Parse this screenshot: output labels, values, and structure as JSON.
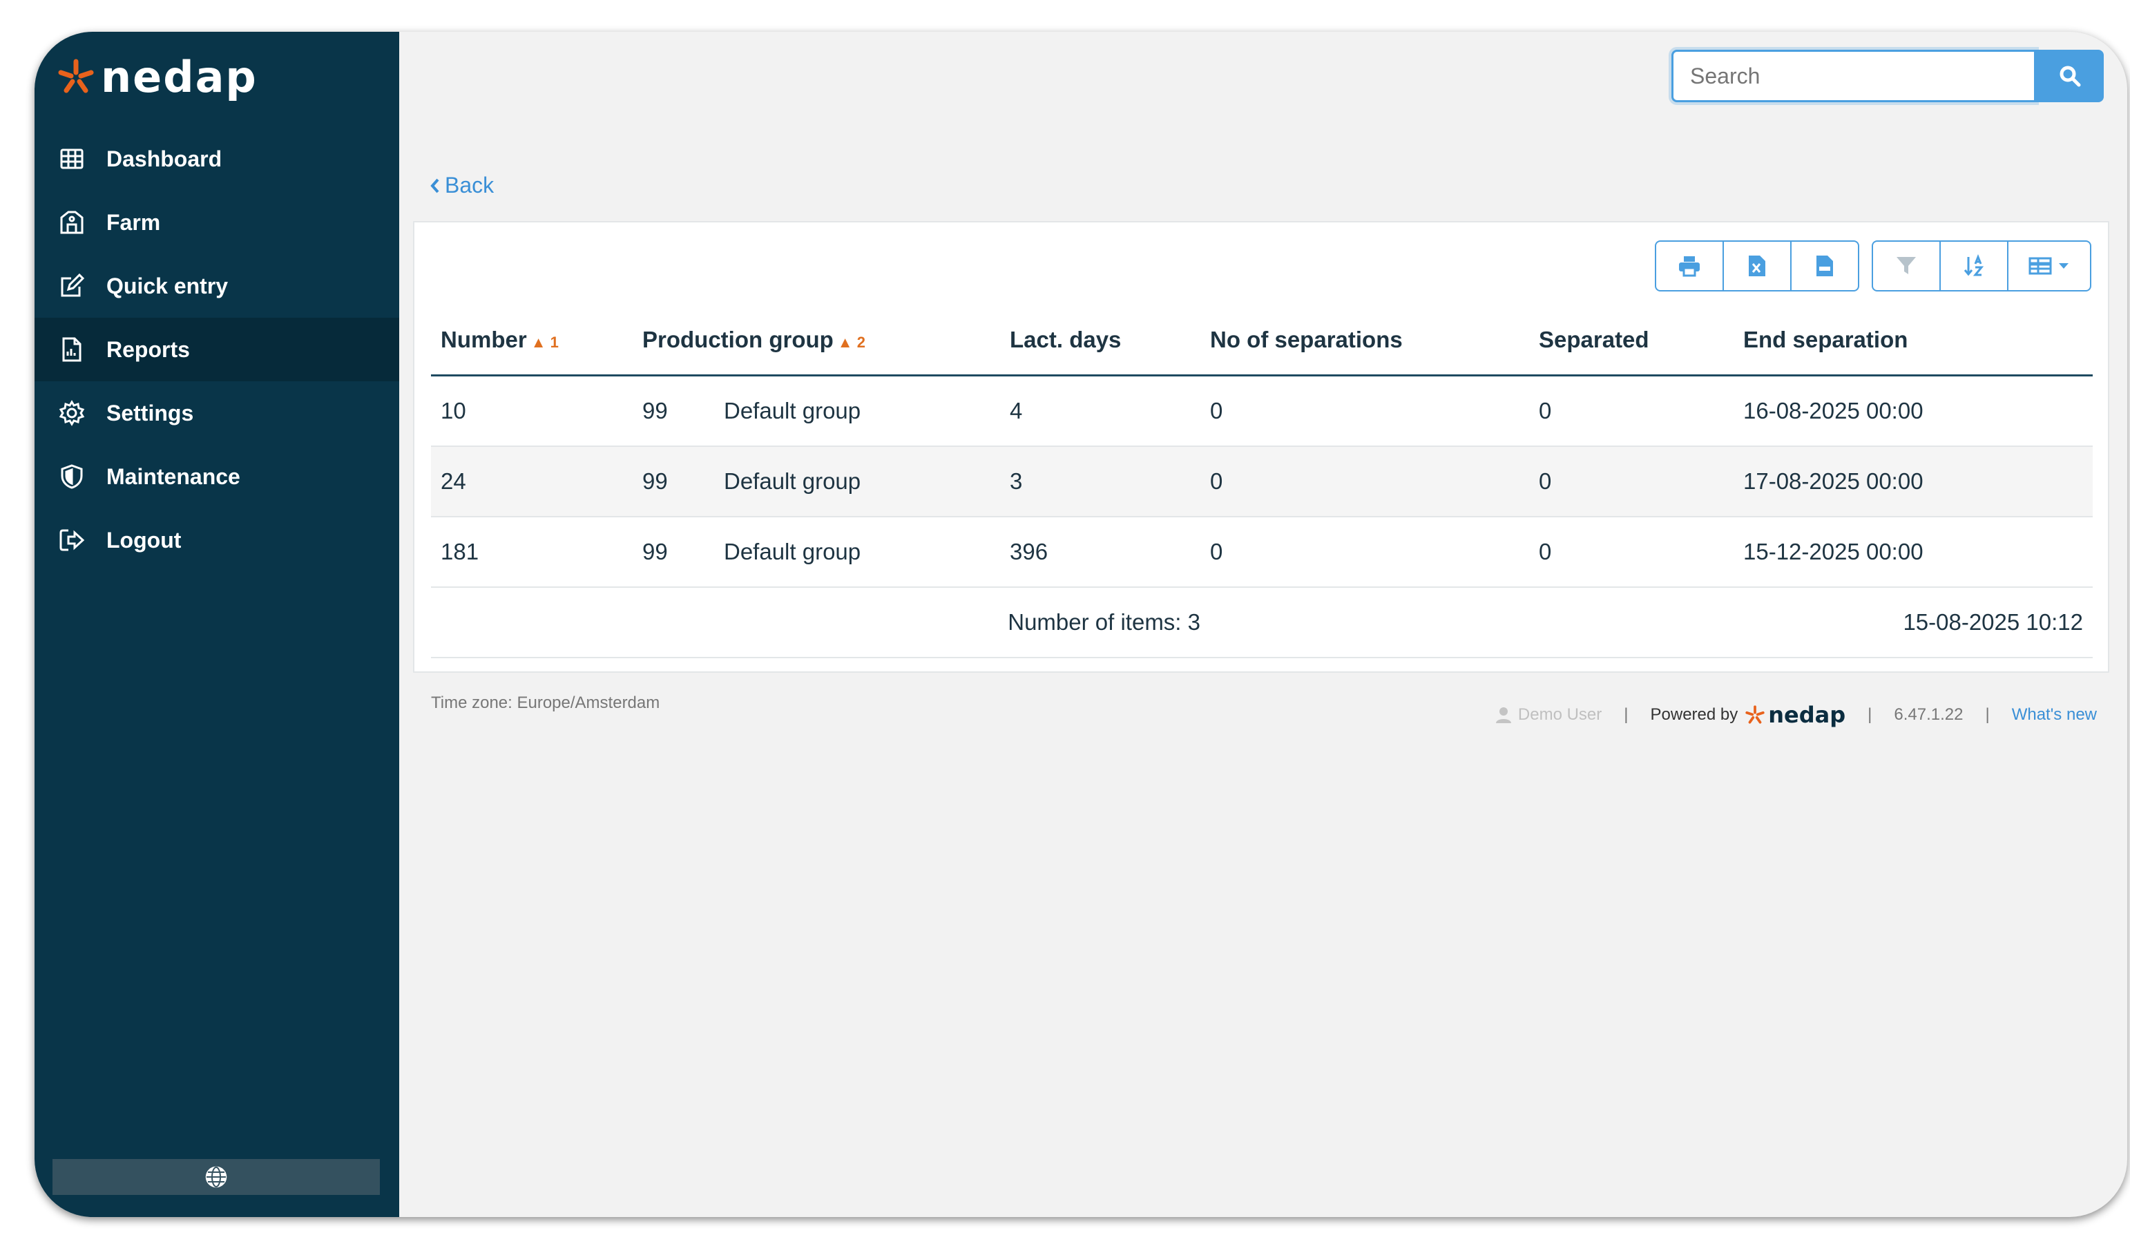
{
  "brand": {
    "name": "nedap",
    "accent": "#e8621c",
    "sidebar_bg": "#093549",
    "link": "#3a8fd6"
  },
  "sidebar": {
    "items": [
      {
        "label": "Dashboard",
        "icon": "grid-icon"
      },
      {
        "label": "Farm",
        "icon": "barn-icon"
      },
      {
        "label": "Quick entry",
        "icon": "edit-icon"
      },
      {
        "label": "Reports",
        "icon": "report-icon",
        "active": true
      },
      {
        "label": "Settings",
        "icon": "gear-icon"
      },
      {
        "label": "Maintenance",
        "icon": "shield-icon"
      },
      {
        "label": "Logout",
        "icon": "logout-icon"
      }
    ],
    "language_icon": "globe-icon"
  },
  "search": {
    "placeholder": "Search"
  },
  "back_label": "Back",
  "toolbar": {
    "export_buttons": [
      "print-icon",
      "excel-icon",
      "csv-icon"
    ],
    "view_buttons": [
      "filter-icon",
      "sort-icon",
      "columns-icon"
    ]
  },
  "table": {
    "columns": [
      {
        "label": "Number",
        "sort": "1"
      },
      {
        "label": "Production group",
        "sort": "2"
      },
      {
        "label": "Lact. days"
      },
      {
        "label": "No of separations"
      },
      {
        "label": "Separated"
      },
      {
        "label": "End separation"
      }
    ],
    "rows": [
      {
        "number": "10",
        "group_no": "99",
        "group_name": "Default group",
        "lact_days": "4",
        "separations": "0",
        "separated": "0",
        "end": "16-08-2025 00:00"
      },
      {
        "number": "24",
        "group_no": "99",
        "group_name": "Default group",
        "lact_days": "3",
        "separations": "0",
        "separated": "0",
        "end": "17-08-2025 00:00"
      },
      {
        "number": "181",
        "group_no": "99",
        "group_name": "Default group",
        "lact_days": "396",
        "separations": "0",
        "separated": "0",
        "end": "15-12-2025 00:00"
      }
    ],
    "footer_count": "Number of items: 3",
    "footer_timestamp": "15-08-2025 10:12"
  },
  "footer": {
    "timezone": "Time zone: Europe/Amsterdam",
    "user": "Demo User",
    "powered_by": "Powered by",
    "powered_brand": "nedap",
    "version": "6.47.1.22",
    "whats_new": "What's new"
  }
}
